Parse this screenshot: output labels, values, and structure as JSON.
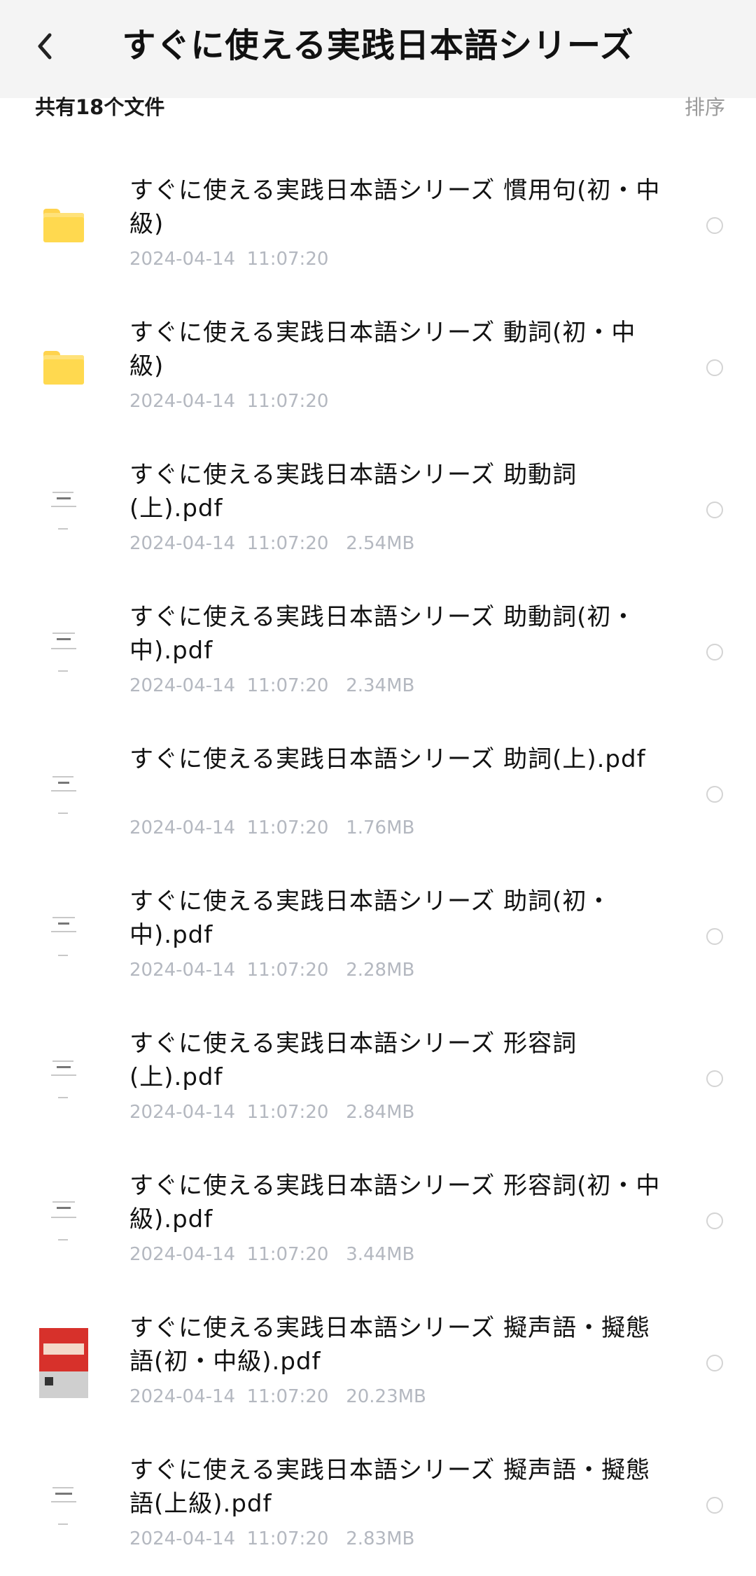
{
  "header": {
    "title": "すぐに使える実践日本語シリーズ",
    "back_icon": "chevron-left-icon"
  },
  "summary": {
    "count_text": "共有18个文件",
    "sort_label": "排序"
  },
  "files": [
    {
      "type": "folder",
      "name": "すぐに使える実践日本語シリーズ 慣用句(初・中級)",
      "meta": "2024-04-14  11:07:20"
    },
    {
      "type": "folder",
      "name": "すぐに使える実践日本語シリーズ 動詞(初・中級)",
      "meta": "2024-04-14  11:07:20"
    },
    {
      "type": "pdf",
      "name": "すぐに使える実践日本語シリーズ 助動詞(上).pdf",
      "meta": "2024-04-14  11:07:20   2.54MB"
    },
    {
      "type": "pdf",
      "name": "すぐに使える実践日本語シリーズ 助動詞(初・中).pdf",
      "meta": "2024-04-14  11:07:20   2.34MB"
    },
    {
      "type": "pdf",
      "name": "すぐに使える実践日本語シリーズ 助詞(上).pdf",
      "meta": "2024-04-14  11:07:20   1.76MB"
    },
    {
      "type": "pdf",
      "name": "すぐに使える実践日本語シリーズ 助詞(初・中).pdf",
      "meta": "2024-04-14  11:07:20   2.28MB"
    },
    {
      "type": "pdf",
      "name": "すぐに使える実践日本語シリーズ 形容詞(上).pdf",
      "meta": "2024-04-14  11:07:20   2.84MB"
    },
    {
      "type": "pdf",
      "name": "すぐに使える実践日本語シリーズ 形容詞(初・中級).pdf",
      "meta": "2024-04-14  11:07:20   3.44MB"
    },
    {
      "type": "pdf-cover",
      "name": "すぐに使える実践日本語シリーズ 擬声語・擬態語(初・中級).pdf",
      "meta": "2024-04-14  11:07:20   20.23MB"
    },
    {
      "type": "pdf",
      "name": "すぐに使える実践日本語シリーズ 擬声語・擬態語(上級).pdf",
      "meta": "2024-04-14  11:07:20   2.83MB"
    }
  ],
  "colors": {
    "folder": "#ffd94f",
    "meta_text": "#b4b8c0",
    "header_bg": "#f4f4f4"
  }
}
